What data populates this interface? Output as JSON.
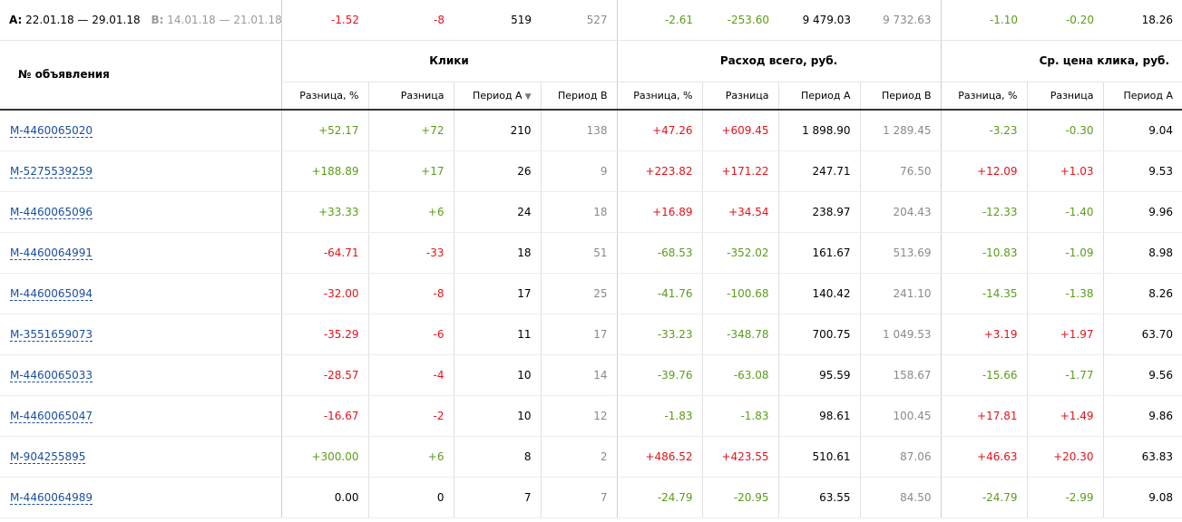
{
  "summary": {
    "a_label": "A:",
    "a_range": "22.01.18 — 29.01.18",
    "b_label": "B:",
    "b_range": "14.01.18 — 21.01.18",
    "cells": [
      {
        "text": "-1.52",
        "tone": "neg"
      },
      {
        "text": "-8",
        "tone": "neg"
      },
      {
        "text": "519",
        "tone": "blk"
      },
      {
        "text": "527",
        "tone": "grey"
      },
      {
        "text": "-2.61",
        "tone": "pos"
      },
      {
        "text": "-253.60",
        "tone": "pos"
      },
      {
        "text": "9 479.03",
        "tone": "blk"
      },
      {
        "text": "9 732.63",
        "tone": "grey"
      },
      {
        "text": "-1.10",
        "tone": "pos"
      },
      {
        "text": "-0.20",
        "tone": "pos"
      },
      {
        "text": "18.26",
        "tone": "blk"
      }
    ]
  },
  "header": {
    "ad_number": "№ объявления",
    "clicks": "Клики",
    "cost": "Расход всего, руб.",
    "cpc": "Ср. цена клика, руб.",
    "sub": {
      "diff_pct": "Разница, %",
      "diff": "Разница",
      "period_a": "Период А",
      "period_b": "Период В",
      "sort_icon": "▼"
    }
  },
  "rows": [
    {
      "ad": "M-4460065020",
      "cells": [
        [
          "+52.17",
          "pos"
        ],
        [
          "+72",
          "pos"
        ],
        [
          "210",
          "blk"
        ],
        [
          "138",
          "grey"
        ],
        [
          "+47.26",
          "neg"
        ],
        [
          "+609.45",
          "neg"
        ],
        [
          "1 898.90",
          "blk"
        ],
        [
          "1 289.45",
          "grey"
        ],
        [
          "-3.23",
          "pos"
        ],
        [
          "-0.30",
          "pos"
        ],
        [
          "9.04",
          "blk"
        ]
      ]
    },
    {
      "ad": "M-5275539259",
      "cells": [
        [
          "+188.89",
          "pos"
        ],
        [
          "+17",
          "pos"
        ],
        [
          "26",
          "blk"
        ],
        [
          "9",
          "grey"
        ],
        [
          "+223.82",
          "neg"
        ],
        [
          "+171.22",
          "neg"
        ],
        [
          "247.71",
          "blk"
        ],
        [
          "76.50",
          "grey"
        ],
        [
          "+12.09",
          "neg"
        ],
        [
          "+1.03",
          "neg"
        ],
        [
          "9.53",
          "blk"
        ]
      ]
    },
    {
      "ad": "M-4460065096",
      "cells": [
        [
          "+33.33",
          "pos"
        ],
        [
          "+6",
          "pos"
        ],
        [
          "24",
          "blk"
        ],
        [
          "18",
          "grey"
        ],
        [
          "+16.89",
          "neg"
        ],
        [
          "+34.54",
          "neg"
        ],
        [
          "238.97",
          "blk"
        ],
        [
          "204.43",
          "grey"
        ],
        [
          "-12.33",
          "pos"
        ],
        [
          "-1.40",
          "pos"
        ],
        [
          "9.96",
          "blk"
        ]
      ]
    },
    {
      "ad": "M-4460064991",
      "cells": [
        [
          "-64.71",
          "neg"
        ],
        [
          "-33",
          "neg"
        ],
        [
          "18",
          "blk"
        ],
        [
          "51",
          "grey"
        ],
        [
          "-68.53",
          "pos"
        ],
        [
          "-352.02",
          "pos"
        ],
        [
          "161.67",
          "blk"
        ],
        [
          "513.69",
          "grey"
        ],
        [
          "-10.83",
          "pos"
        ],
        [
          "-1.09",
          "pos"
        ],
        [
          "8.98",
          "blk"
        ]
      ]
    },
    {
      "ad": "M-4460065094",
      "cells": [
        [
          "-32.00",
          "neg"
        ],
        [
          "-8",
          "neg"
        ],
        [
          "17",
          "blk"
        ],
        [
          "25",
          "grey"
        ],
        [
          "-41.76",
          "pos"
        ],
        [
          "-100.68",
          "pos"
        ],
        [
          "140.42",
          "blk"
        ],
        [
          "241.10",
          "grey"
        ],
        [
          "-14.35",
          "pos"
        ],
        [
          "-1.38",
          "pos"
        ],
        [
          "8.26",
          "blk"
        ]
      ]
    },
    {
      "ad": "M-3551659073",
      "cells": [
        [
          "-35.29",
          "neg"
        ],
        [
          "-6",
          "neg"
        ],
        [
          "11",
          "blk"
        ],
        [
          "17",
          "grey"
        ],
        [
          "-33.23",
          "pos"
        ],
        [
          "-348.78",
          "pos"
        ],
        [
          "700.75",
          "blk"
        ],
        [
          "1 049.53",
          "grey"
        ],
        [
          "+3.19",
          "neg"
        ],
        [
          "+1.97",
          "neg"
        ],
        [
          "63.70",
          "blk"
        ]
      ]
    },
    {
      "ad": "M-4460065033",
      "cells": [
        [
          "-28.57",
          "neg"
        ],
        [
          "-4",
          "neg"
        ],
        [
          "10",
          "blk"
        ],
        [
          "14",
          "grey"
        ],
        [
          "-39.76",
          "pos"
        ],
        [
          "-63.08",
          "pos"
        ],
        [
          "95.59",
          "blk"
        ],
        [
          "158.67",
          "grey"
        ],
        [
          "-15.66",
          "pos"
        ],
        [
          "-1.77",
          "pos"
        ],
        [
          "9.56",
          "blk"
        ]
      ]
    },
    {
      "ad": "M-4460065047",
      "cells": [
        [
          "-16.67",
          "neg"
        ],
        [
          "-2",
          "neg"
        ],
        [
          "10",
          "blk"
        ],
        [
          "12",
          "grey"
        ],
        [
          "-1.83",
          "pos"
        ],
        [
          "-1.83",
          "pos"
        ],
        [
          "98.61",
          "blk"
        ],
        [
          "100.45",
          "grey"
        ],
        [
          "+17.81",
          "neg"
        ],
        [
          "+1.49",
          "neg"
        ],
        [
          "9.86",
          "blk"
        ]
      ]
    },
    {
      "ad": "M-904255895",
      "cells": [
        [
          "+300.00",
          "pos"
        ],
        [
          "+6",
          "pos"
        ],
        [
          "8",
          "blk"
        ],
        [
          "2",
          "grey"
        ],
        [
          "+486.52",
          "neg"
        ],
        [
          "+423.55",
          "neg"
        ],
        [
          "510.61",
          "blk"
        ],
        [
          "87.06",
          "grey"
        ],
        [
          "+46.63",
          "neg"
        ],
        [
          "+20.30",
          "neg"
        ],
        [
          "63.83",
          "blk"
        ]
      ]
    },
    {
      "ad": "M-4460064989",
      "cells": [
        [
          "0.00",
          "neu"
        ],
        [
          "0",
          "neu"
        ],
        [
          "7",
          "blk"
        ],
        [
          "7",
          "grey"
        ],
        [
          "-24.79",
          "pos"
        ],
        [
          "-20.95",
          "pos"
        ],
        [
          "63.55",
          "blk"
        ],
        [
          "84.50",
          "grey"
        ],
        [
          "-24.79",
          "pos"
        ],
        [
          "-2.99",
          "pos"
        ],
        [
          "9.08",
          "blk"
        ]
      ]
    }
  ]
}
